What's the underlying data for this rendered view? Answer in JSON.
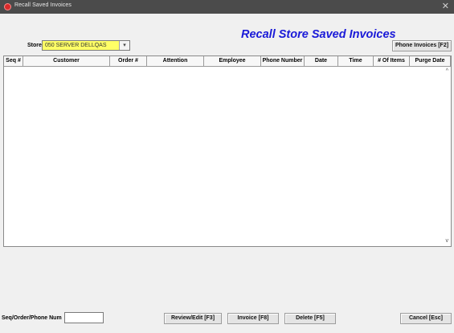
{
  "window": {
    "title": "Recall Saved Invoices",
    "close_glyph": "✕"
  },
  "heading": "Recall Store Saved Invoices",
  "store": {
    "label": "Store",
    "value": "050 SERVER DELLQAS",
    "dropdown_glyph": "▾"
  },
  "phone_invoices_label": "Phone Invoices [F2]",
  "table": {
    "columns": [
      "Seq #",
      "Customer",
      "Order #",
      "Attention",
      "Employee",
      "Phone Number",
      "Date",
      "Time",
      "# Of Items",
      "Purge Date"
    ],
    "rows": [],
    "scroll_up_glyph": "^",
    "scroll_down_glyph": "v"
  },
  "search": {
    "label": "Seq/Order/Phone Num",
    "value": ""
  },
  "buttons": {
    "review_edit": "Review/Edit [F3]",
    "invoice": "Invoice [F8]",
    "delete": "Delete [F5]",
    "cancel": "Cancel [Esc]"
  },
  "colors": {
    "heading": "#1a1ad8",
    "store_field": "#ffff66",
    "titlebar": "#4b4b4b"
  }
}
